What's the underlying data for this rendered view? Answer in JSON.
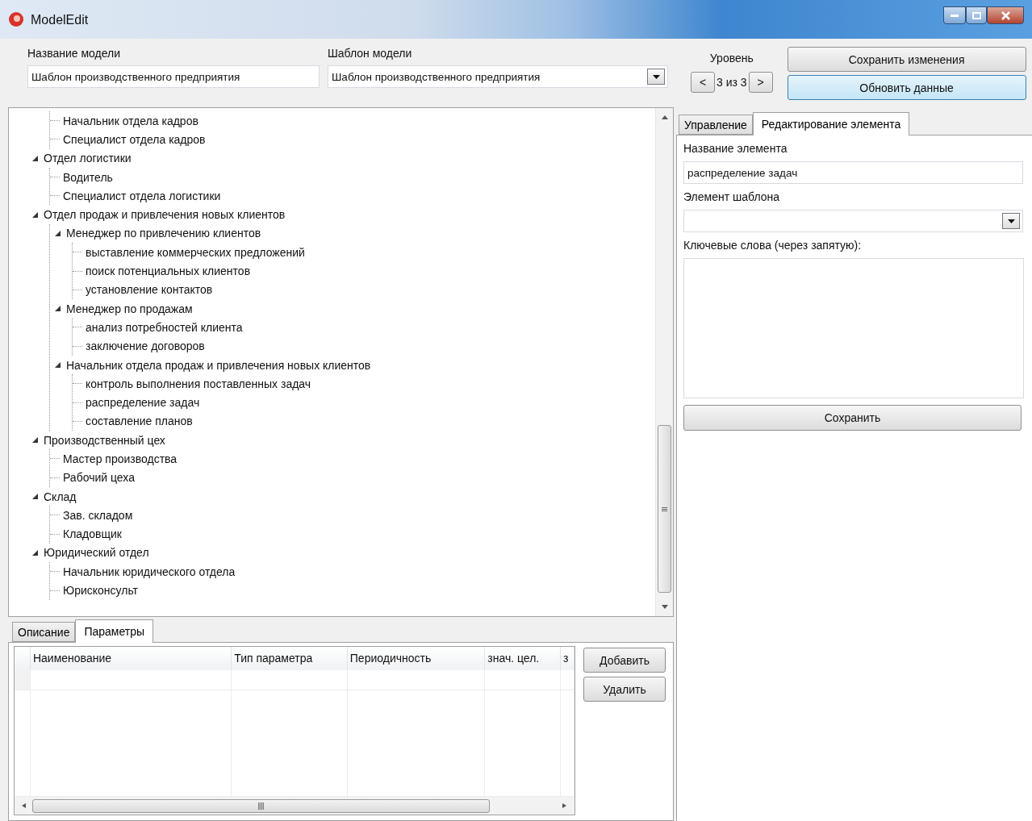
{
  "window": {
    "title": "ModelEdit"
  },
  "model": {
    "name_label": "Название модели",
    "name_value": "Шаблон производственного предприятия",
    "template_label": "Шаблон модели",
    "template_value": "Шаблон производственного предприятия"
  },
  "level": {
    "label": "Уровень",
    "prev": "<",
    "reading": "3 из 3",
    "next": ">"
  },
  "actions": [
    {
      "label": "Сохранить изменения",
      "selected": false
    },
    {
      "label": "Обновить данные",
      "selected": true
    }
  ],
  "tree": [
    {
      "expanded": true,
      "children": [
        {
          "label": "Начальник отдела кадров"
        },
        {
          "label": "Специалист отдела кадров"
        }
      ]
    },
    {
      "label": "Отдел логистики",
      "expanded": true,
      "children": [
        {
          "label": "Водитель"
        },
        {
          "label": "Специалист отдела логистики"
        }
      ]
    },
    {
      "label": "Отдел продаж и привлечения новых клиентов",
      "expanded": true,
      "children": [
        {
          "label": "Менеджер по привлечению клиентов",
          "expanded": true,
          "children": [
            {
              "label": "выставление коммерческих предложений"
            },
            {
              "label": "поиск потенциальных клиентов"
            },
            {
              "label": "установление контактов"
            }
          ]
        },
        {
          "label": "Менеджер по продажам",
          "expanded": true,
          "children": [
            {
              "label": "анализ потребностей клиента"
            },
            {
              "label": "заключение договоров"
            }
          ]
        },
        {
          "label": "Начальник отдела продаж и привлечения новых клиентов",
          "expanded": true,
          "children": [
            {
              "label": "контроль выполнения поставленных задач"
            },
            {
              "label": "распределение задач"
            },
            {
              "label": "составление планов"
            }
          ]
        }
      ]
    },
    {
      "label": "Производственный цех",
      "expanded": true,
      "children": [
        {
          "label": "Мастер производства"
        },
        {
          "label": "Рабочий цеха"
        }
      ]
    },
    {
      "label": "Склад",
      "expanded": true,
      "children": [
        {
          "label": "Зав. складом"
        },
        {
          "label": "Кладовщик"
        }
      ]
    },
    {
      "label": "Юридический отдел",
      "expanded": true,
      "children": [
        {
          "label": "Начальник юридического отдела"
        },
        {
          "label": "Юрисконсульт"
        }
      ]
    }
  ],
  "bottom_tabs": [
    {
      "label": "Описание",
      "selected": false
    },
    {
      "label": "Параметры",
      "selected": true
    }
  ],
  "table": {
    "columns": [
      "Наименование",
      "Тип параметра",
      "Периодичность",
      "знач. цел.",
      "з"
    ]
  },
  "table_buttons": [
    "Добавить",
    "Удалить"
  ],
  "right_tabs": [
    {
      "label": "Управление",
      "selected": false
    },
    {
      "label": "Редактирование элемента",
      "selected": true
    }
  ],
  "editor": {
    "name_label": "Название элемента",
    "name_value": "распределение задач",
    "template_label": "Элемент шаблона",
    "keywords_label": "Ключевые слова (через запятую):",
    "save": "Сохранить"
  }
}
